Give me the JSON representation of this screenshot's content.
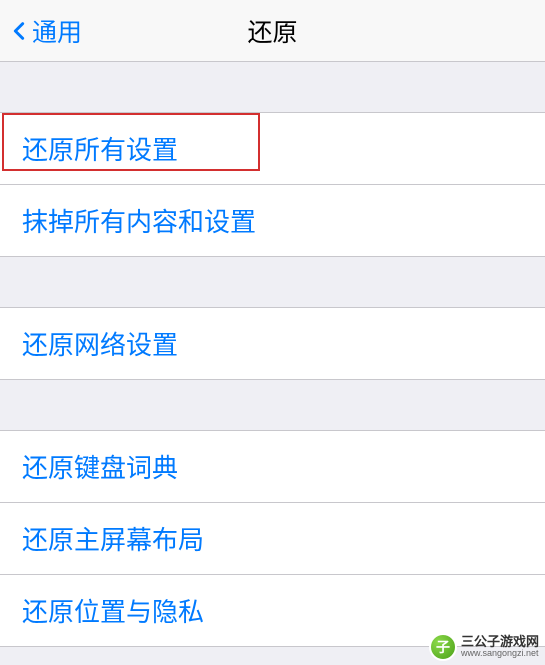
{
  "navbar": {
    "back_label": "通用",
    "title": "还原"
  },
  "groups": [
    {
      "items": [
        {
          "id": "reset-all-settings",
          "label": "还原所有设置",
          "highlighted": true
        },
        {
          "id": "erase-all-content",
          "label": "抹掉所有内容和设置"
        }
      ]
    },
    {
      "items": [
        {
          "id": "reset-network",
          "label": "还原网络设置"
        }
      ]
    },
    {
      "items": [
        {
          "id": "reset-keyboard-dict",
          "label": "还原键盘词典"
        },
        {
          "id": "reset-home-layout",
          "label": "还原主屏幕布局"
        },
        {
          "id": "reset-location-privacy",
          "label": "还原位置与隐私"
        }
      ]
    }
  ],
  "watermark": {
    "cn": "三公子游戏网",
    "en": "www.sangongzi.net"
  },
  "colors": {
    "link": "#007aff",
    "background": "#efeff4",
    "highlight_border": "#d32f2f"
  }
}
